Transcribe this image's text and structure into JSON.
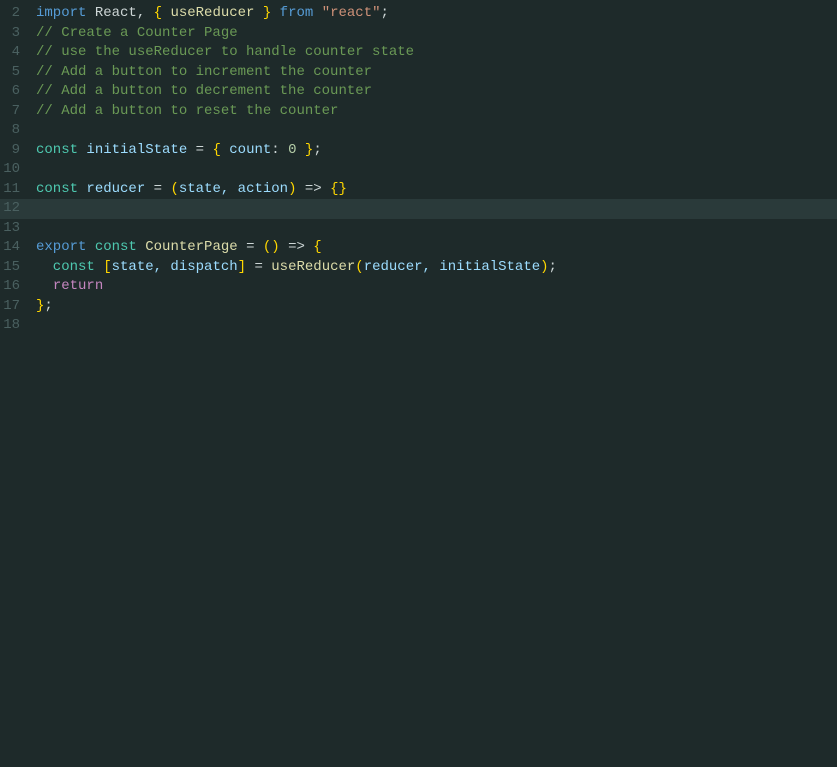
{
  "editor": {
    "background": "#1e2a2a",
    "lines": [
      {
        "num": "2",
        "tokens": [
          {
            "text": "import",
            "cls": "kw-import"
          },
          {
            "text": " React, ",
            "cls": "punct"
          },
          {
            "text": "{",
            "cls": "bracket"
          },
          {
            "text": " useReducer ",
            "cls": "fn-name"
          },
          {
            "text": "}",
            "cls": "bracket"
          },
          {
            "text": " from ",
            "cls": "kw-import"
          },
          {
            "text": "\"react\"",
            "cls": "string"
          },
          {
            "text": ";",
            "cls": "punct"
          }
        ]
      },
      {
        "num": "3",
        "tokens": [
          {
            "text": "// Create a Counter Page",
            "cls": "comment"
          }
        ]
      },
      {
        "num": "4",
        "tokens": [
          {
            "text": "// use the useReducer to handle counter state",
            "cls": "comment"
          }
        ]
      },
      {
        "num": "5",
        "tokens": [
          {
            "text": "// Add a button to increment the counter",
            "cls": "comment"
          }
        ]
      },
      {
        "num": "6",
        "tokens": [
          {
            "text": "// Add a button to decrement the counter",
            "cls": "comment"
          }
        ]
      },
      {
        "num": "7",
        "tokens": [
          {
            "text": "// Add a button to reset the counter",
            "cls": "comment"
          }
        ]
      },
      {
        "num": "8",
        "tokens": []
      },
      {
        "num": "9",
        "tokens": [
          {
            "text": "const",
            "cls": "kw-const"
          },
          {
            "text": " initialState ",
            "cls": "var-name"
          },
          {
            "text": "= ",
            "cls": "punct"
          },
          {
            "text": "{",
            "cls": "bracket"
          },
          {
            "text": " count",
            "cls": "obj-key"
          },
          {
            "text": ": ",
            "cls": "punct"
          },
          {
            "text": "0",
            "cls": "number"
          },
          {
            "text": " ",
            "cls": "punct"
          },
          {
            "text": "}",
            "cls": "bracket"
          },
          {
            "text": ";",
            "cls": "punct"
          }
        ]
      },
      {
        "num": "10",
        "tokens": []
      },
      {
        "num": "11",
        "tokens": [
          {
            "text": "const",
            "cls": "kw-const"
          },
          {
            "text": " reducer ",
            "cls": "var-name"
          },
          {
            "text": "= ",
            "cls": "punct"
          },
          {
            "text": "(",
            "cls": "bracket"
          },
          {
            "text": "state, action",
            "cls": "var-name"
          },
          {
            "text": ")",
            "cls": "bracket"
          },
          {
            "text": " => ",
            "cls": "punct"
          },
          {
            "text": "{}",
            "cls": "bracket"
          }
        ]
      },
      {
        "num": "12",
        "tokens": [],
        "active": true
      },
      {
        "num": "13",
        "tokens": []
      },
      {
        "num": "14",
        "tokens": [
          {
            "text": "export",
            "cls": "kw-export"
          },
          {
            "text": " ",
            "cls": "punct"
          },
          {
            "text": "const",
            "cls": "kw-const"
          },
          {
            "text": " CounterPage ",
            "cls": "fn-name"
          },
          {
            "text": "= ",
            "cls": "punct"
          },
          {
            "text": "()",
            "cls": "bracket"
          },
          {
            "text": " => ",
            "cls": "punct"
          },
          {
            "text": "{",
            "cls": "bracket"
          }
        ]
      },
      {
        "num": "15",
        "tokens": [
          {
            "text": "  const",
            "cls": "kw-const"
          },
          {
            "text": " ",
            "cls": "punct"
          },
          {
            "text": "[",
            "cls": "bracket"
          },
          {
            "text": "state, dispatch",
            "cls": "var-name"
          },
          {
            "text": "]",
            "cls": "bracket"
          },
          {
            "text": " = ",
            "cls": "punct"
          },
          {
            "text": "useReducer",
            "cls": "fn-name"
          },
          {
            "text": "(",
            "cls": "bracket"
          },
          {
            "text": "reducer, initialState",
            "cls": "var-name"
          },
          {
            "text": ")",
            "cls": "bracket"
          },
          {
            "text": ";",
            "cls": "punct"
          }
        ]
      },
      {
        "num": "16",
        "tokens": [
          {
            "text": "  ",
            "cls": "punct"
          },
          {
            "text": "return",
            "cls": "kw-return"
          }
        ]
      },
      {
        "num": "17",
        "tokens": [
          {
            "text": "}",
            "cls": "bracket"
          },
          {
            "text": ";",
            "cls": "punct"
          }
        ]
      },
      {
        "num": "18",
        "tokens": []
      }
    ]
  }
}
